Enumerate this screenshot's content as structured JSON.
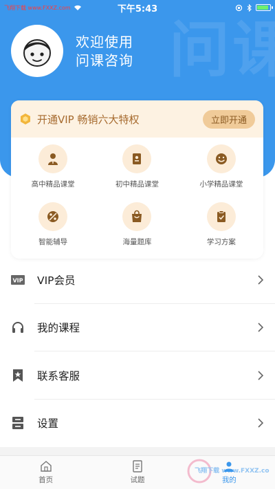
{
  "status_bar": {
    "left_text": "飞翔下载 www.FXXZ.com",
    "time": "下午5:43"
  },
  "hero": {
    "welcome_line1": "欢迎使用",
    "welcome_line2": "问课咨询",
    "watermark_text": "问课"
  },
  "vip": {
    "text": "开通VIP 畅销六大特权",
    "button": "立即开通"
  },
  "grid": [
    {
      "label": "高中精品课堂",
      "icon": "teacher-icon"
    },
    {
      "label": "初中精品课堂",
      "icon": "book-icon"
    },
    {
      "label": "小学精品课堂",
      "icon": "smile-icon"
    },
    {
      "label": "智能辅导",
      "icon": "smart-tutor-icon"
    },
    {
      "label": "海量题库",
      "icon": "bag-icon"
    },
    {
      "label": "学习方案",
      "icon": "clipboard-icon"
    }
  ],
  "menu": [
    {
      "label": "VIP会员",
      "icon": "vip-icon"
    },
    {
      "label": "我的课程",
      "icon": "headphones-icon"
    },
    {
      "label": "联系客服",
      "icon": "bookmark-star-icon"
    },
    {
      "label": "设置",
      "icon": "settings-icon"
    }
  ],
  "tabs": [
    {
      "label": "首页",
      "icon": "home-icon"
    },
    {
      "label": "试题",
      "icon": "document-icon"
    },
    {
      "label": "我的",
      "icon": "profile-icon"
    }
  ],
  "watermark_logo": "飞翔下载 www.FXXZ.com",
  "colors": {
    "primary": "#3b97ec",
    "vip_bg": "#fdf2e2",
    "vip_button": "#f0cb99",
    "icon_circle": "#fcecd8",
    "icon_brown": "#8a5a22"
  }
}
